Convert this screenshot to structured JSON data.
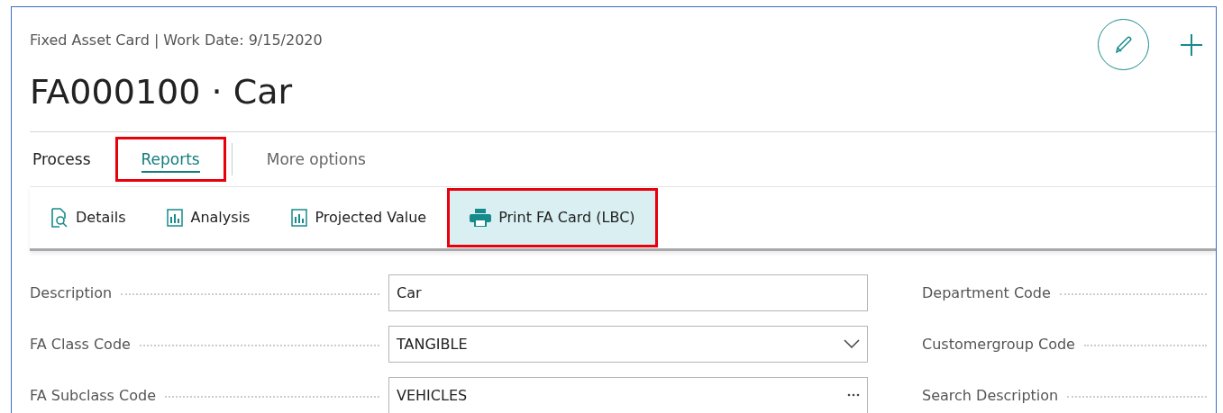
{
  "caption": "Fixed Asset Card | Work Date: 9/15/2020",
  "title": "FA000100 · Car",
  "tabs": [
    {
      "label": "Process",
      "selected": false,
      "highlighted": false
    },
    {
      "label": "Reports",
      "selected": true,
      "highlighted": true
    },
    {
      "label": "More options",
      "selected": false,
      "highlighted": false,
      "kind": "more"
    }
  ],
  "actions": [
    {
      "label": "Details",
      "kind": "search-doc",
      "selected": false,
      "highlighted": false
    },
    {
      "label": "Analysis",
      "kind": "chart",
      "selected": false,
      "highlighted": false
    },
    {
      "label": "Projected Value",
      "kind": "chart",
      "selected": false,
      "highlighted": false
    },
    {
      "label": "Print FA Card (LBC)",
      "kind": "printer",
      "selected": true,
      "highlighted": true
    }
  ],
  "fields": [
    {
      "label": "Description",
      "value": "Car",
      "kind": "text"
    },
    {
      "label": "FA Class Code",
      "value": "TANGIBLE",
      "kind": "select"
    },
    {
      "label": "FA Subclass Code",
      "value": "VEHICLES",
      "kind": "lookup"
    }
  ],
  "right_fields": [
    {
      "label": "Department Code"
    },
    {
      "label": "Customergroup Code"
    },
    {
      "label": "Search Description"
    }
  ]
}
